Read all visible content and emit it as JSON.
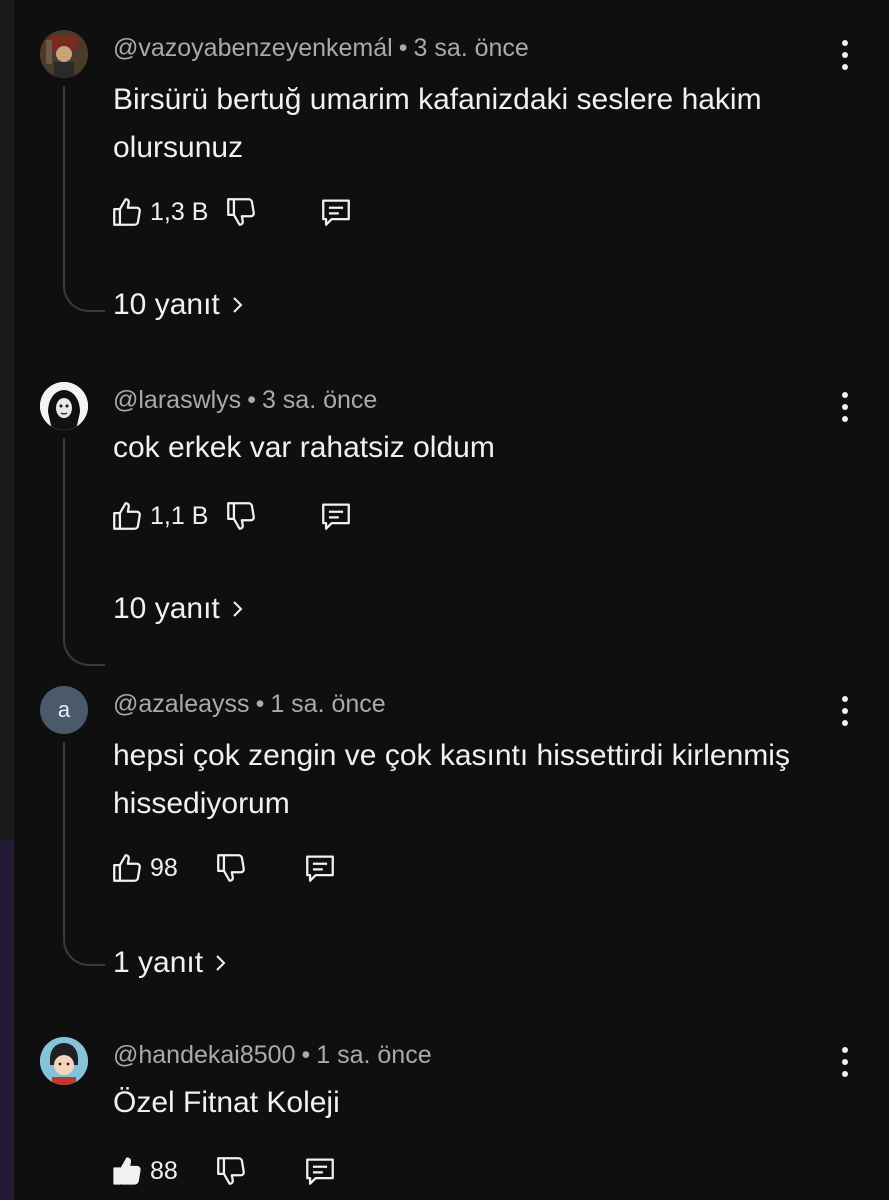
{
  "comments": [
    {
      "handle": "@vazoyabenzeyenkemál",
      "time": "3 sa. önce",
      "text": "Birsürü bertuğ umarim kafanizdaki seslere hakim olursunuz",
      "likes": "1,3 B",
      "replies": "10 yanıt",
      "avatar_icon": "photo-avatar"
    },
    {
      "handle": "@laraswlys",
      "time": "3 sa. önce",
      "text": "cok erkek var rahatsiz oldum",
      "likes": "1,1 B",
      "replies": "10 yanıt",
      "avatar_icon": "sketch-avatar"
    },
    {
      "handle": "@azaleayss",
      "time": "1 sa. önce",
      "text": "hepsi çok zengin ve çok kasıntı hissettirdi kirlenmiş hissediyorum",
      "likes": "98",
      "replies": "1 yanıt",
      "avatar_letter": "a",
      "avatar_icon": "letter-avatar"
    },
    {
      "handle": "@handekai8500",
      "time": "1 sa. önce",
      "text": "Özel Fitnat Koleji",
      "likes": "88",
      "avatar_icon": "cartoon-avatar"
    }
  ],
  "icons": {
    "like": "thumbs-up-icon",
    "like_filled": "thumbs-up-filled-icon",
    "dislike": "thumbs-down-icon",
    "reply": "comment-icon",
    "menu": "more-vertical-icon",
    "chevron": "chevron-right-icon"
  },
  "colors": {
    "background": "#0f0f0f",
    "text": "#f1f1f1",
    "meta": "#aaaaaa",
    "thread_line": "#3a3a3a"
  }
}
